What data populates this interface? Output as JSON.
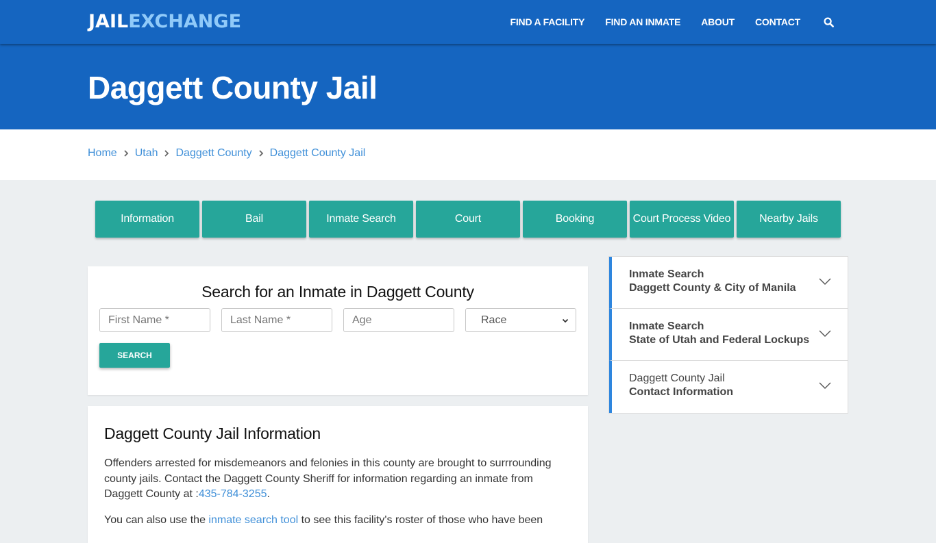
{
  "header": {
    "logo_part1": "JAIL",
    "logo_part2": "EXCHANGE",
    "nav": [
      {
        "label": "FIND A FACILITY"
      },
      {
        "label": "FIND AN INMATE"
      },
      {
        "label": "ABOUT"
      },
      {
        "label": "CONTACT"
      }
    ],
    "search_icon": "search-icon"
  },
  "hero": {
    "title": "Daggett County Jail"
  },
  "breadcrumb": [
    {
      "label": "Home"
    },
    {
      "label": "Utah"
    },
    {
      "label": "Daggett County"
    },
    {
      "label": "Daggett County Jail"
    }
  ],
  "tabs": [
    {
      "label": "Information"
    },
    {
      "label": "Bail"
    },
    {
      "label": "Inmate Search"
    },
    {
      "label": "Court"
    },
    {
      "label": "Booking"
    },
    {
      "label": "Court Process Video"
    },
    {
      "label": "Nearby Jails"
    }
  ],
  "search_form": {
    "title": "Search for an Inmate in Daggett County",
    "first_name_placeholder": "First Name *",
    "last_name_placeholder": "Last Name *",
    "age_placeholder": "Age",
    "race_selected": "Race",
    "submit_label": "SEARCH"
  },
  "info": {
    "title": "Daggett County Jail Information",
    "p1_text": "Offenders arrested for misdemeanors and felonies in this county are brought to surrrounding county jails. Contact the Daggett County Sheriff for information regarding an inmate from Daggett County at :",
    "p1_phone": "435-784-3255",
    "p1_end": ".",
    "p2_start": "You can also use the ",
    "p2_link": "inmate search tool",
    "p2_end": " to see this facility's roster of those who have been"
  },
  "accordion": [
    {
      "line1": "Inmate Search",
      "line2": "Daggett County & City of Manila",
      "line1_bold": true
    },
    {
      "line1": "Inmate Search",
      "line2": "State of Utah and Federal Lockups",
      "line1_bold": true
    },
    {
      "line1": "Daggett County Jail",
      "line2": "Contact Information",
      "line1_bold": false
    }
  ],
  "colors": {
    "primary_blue": "#1565c0",
    "logo_accent": "#90caf9",
    "teal": "#26a69a",
    "link": "#3f8fd8",
    "accordion_accent": "#2e86de",
    "page_bg": "#eceff1"
  }
}
